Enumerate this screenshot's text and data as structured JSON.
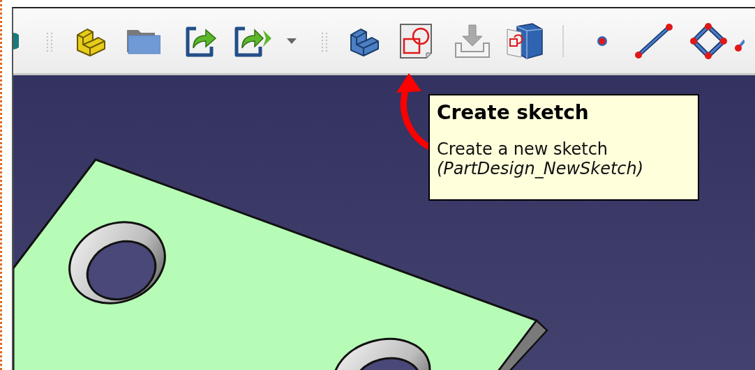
{
  "tooltip": {
    "title": "Create sketch",
    "description": "Create a new sketch",
    "command": "(PartDesign_NewSketch)"
  }
}
